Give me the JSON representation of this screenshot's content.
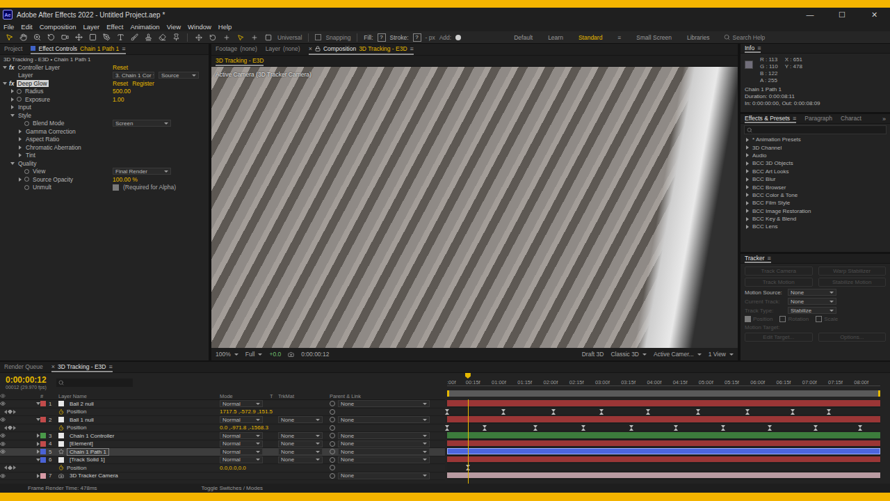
{
  "window": {
    "logo": "Ae",
    "title": "Adobe After Effects 2022 - Untitled Project.aep *",
    "controls": [
      "—",
      "☐",
      "✕"
    ]
  },
  "menu": [
    "File",
    "Edit",
    "Composition",
    "Layer",
    "Effect",
    "Animation",
    "View",
    "Window",
    "Help"
  ],
  "toolbar": {
    "tools": [
      {
        "selected": true
      },
      {
        "selected": false
      },
      {
        "selected": false
      },
      {
        "selected": false
      },
      {
        "selected": false
      },
      {
        "selected": false
      },
      {
        "selected": false
      },
      {
        "selected": false
      },
      {
        "selected": false
      },
      {
        "selected": false
      },
      {
        "selected": false
      },
      {
        "selected": false
      },
      {
        "selected": false
      }
    ],
    "axis_tools": [
      {
        "selected": false
      },
      {
        "selected": false
      },
      {
        "selected": false
      },
      {
        "selected": true
      },
      {
        "selected": false
      },
      {
        "selected": false
      }
    ],
    "axis_mode": "Universal",
    "snapping": {
      "label": "Snapping",
      "checked": false
    },
    "fill_label": "Fill:",
    "fill_value": "?",
    "stroke_label": "Stroke:",
    "stroke_value": "?",
    "stroke_width": "- px",
    "add_label": "Add:"
  },
  "workspaces": [
    {
      "label": "Default",
      "selected": false
    },
    {
      "label": "Learn",
      "selected": false
    },
    {
      "label": "Standard",
      "selected": true
    },
    {
      "label": "Small Screen",
      "selected": false
    },
    {
      "label": "Libraries",
      "selected": false
    }
  ],
  "workspace_menu": "≡",
  "help_search": {
    "placeholder": "Search Help"
  },
  "effect_controls": {
    "tabs": [
      {
        "label": "Project",
        "target": "",
        "selected": false
      },
      {
        "label": "Effect Controls",
        "target": "Chain 1 Path 1",
        "selected": true
      }
    ],
    "menu": "≡",
    "breadcrumb": "3D Tracking - E3D • Chain 1 Path 1",
    "fx_mark": "fx",
    "rows": [
      {
        "kind": "fx",
        "label": "Controller Layer",
        "depth": 0,
        "expanded": true,
        "selected": false,
        "actions": [
          "Reset"
        ]
      },
      {
        "kind": "dropdowns",
        "label": "Layer",
        "depth": 1,
        "values": [
          "3. Chain 1 Cor",
          "Source"
        ]
      },
      {
        "kind": "fx",
        "label": "Deep Glow",
        "depth": 0,
        "expanded": true,
        "selected": true,
        "actions": [
          "Reset",
          "Register"
        ]
      },
      {
        "kind": "number",
        "label": "Radius",
        "depth": 1,
        "value": "500.00"
      },
      {
        "kind": "number",
        "label": "Exposure",
        "depth": 1,
        "value": "1.00"
      },
      {
        "kind": "group",
        "label": "Input",
        "depth": 1,
        "expanded": false
      },
      {
        "kind": "group",
        "label": "Style",
        "depth": 1,
        "expanded": true
      },
      {
        "kind": "dropdown",
        "label": "Blend Mode",
        "depth": 2,
        "value": "Screen"
      },
      {
        "kind": "group",
        "label": "Gamma Correction",
        "depth": 2,
        "expanded": false
      },
      {
        "kind": "group",
        "label": "Aspect Ratio",
        "depth": 2,
        "expanded": false
      },
      {
        "kind": "group",
        "label": "Chromatic Aberration",
        "depth": 2,
        "expanded": false
      },
      {
        "kind": "group",
        "label": "Tint",
        "depth": 2,
        "expanded": false
      },
      {
        "kind": "group",
        "label": "Quality",
        "depth": 1,
        "expanded": true
      },
      {
        "kind": "dropdown",
        "label": "View",
        "depth": 2,
        "value": "Final Render"
      },
      {
        "kind": "number",
        "label": "Source Opacity",
        "depth": 2,
        "value": "100.00 %"
      },
      {
        "kind": "checkbox",
        "label": "Unmult",
        "depth": 2,
        "checked": true,
        "note": "(Required for Alpha)"
      }
    ]
  },
  "viewer": {
    "tabs": [
      {
        "label": "Footage",
        "target": "(none)",
        "selected": false
      },
      {
        "label": "Layer",
        "target": "(none)",
        "selected": false
      },
      {
        "label": "Composition",
        "target": "3D Tracking - E3D",
        "selected": true
      }
    ],
    "close": "×",
    "menu": "≡",
    "subtab": "3D Tracking - E3D",
    "overlay_label": "Active Camera (3D Tracker Camera)",
    "footer": {
      "zoom": "100%",
      "resolution": "Full",
      "exposure": "+0.0",
      "time": "0:00:00:12",
      "draft": "Draft 3D",
      "renderer": "Classic 3D",
      "view": "Active Camer...",
      "layout": "1 View"
    }
  },
  "info": {
    "title": "Info",
    "menu": "≡",
    "channels": [
      {
        "label": "R :",
        "value": "113"
      },
      {
        "label": "G :",
        "value": "110"
      },
      {
        "label": "B :",
        "value": "122"
      },
      {
        "label": "A :",
        "value": "255"
      }
    ],
    "coords": [
      {
        "label": "X :",
        "value": "651"
      },
      {
        "label": "Y :",
        "value": "478"
      }
    ],
    "lines": [
      "Chain 1 Path 1",
      "Duration: 0:00:08:11",
      "In: 0:00:00:00, Out: 0:00:08:09"
    ]
  },
  "effects_presets": {
    "tabs": [
      {
        "label": "Effects & Presets",
        "selected": true
      },
      {
        "label": "Paragraph",
        "selected": false
      },
      {
        "label": "Charact",
        "selected": false
      }
    ],
    "menu": "≡",
    "overflow": "»",
    "items": [
      "* Animation Presets",
      "3D Channel",
      "Audio",
      "BCC 3D Objects",
      "BCC Art Looks",
      "BCC Blur",
      "BCC Browser",
      "BCC Color & Tone",
      "BCC Film Style",
      "BCC Image Restoration",
      "BCC Key & Blend",
      "BCC Lens"
    ]
  },
  "tracker": {
    "title": "Tracker",
    "menu": "≡",
    "buttons": [
      {
        "label": "Track Camera",
        "disabled": true
      },
      {
        "label": "Warp Stabilizer",
        "disabled": true
      },
      {
        "label": "Track Motion",
        "disabled": true
      },
      {
        "label": "Stabilize Motion",
        "disabled": true
      }
    ],
    "fields": [
      {
        "label": "Motion Source:",
        "value": "None",
        "disabled": false
      },
      {
        "label": "Current Track:",
        "value": "None",
        "disabled": true
      },
      {
        "label": "Track Type:",
        "value": "Stabilize",
        "disabled": true
      }
    ],
    "options": [
      {
        "label": "Position",
        "checked": true,
        "disabled": true
      },
      {
        "label": "Rotation",
        "checked": false,
        "disabled": true
      },
      {
        "label": "Scale",
        "checked": false,
        "disabled": true
      }
    ],
    "target_label": "Motion Target:",
    "actions": [
      {
        "label": "Edit Target...",
        "disabled": true
      },
      {
        "label": "Options...",
        "disabled": true
      }
    ]
  },
  "timeline": {
    "tabs": [
      {
        "label": "Render Queue",
        "selected": false
      },
      {
        "label": "3D Tracking - E3D",
        "selected": true
      }
    ],
    "close": "×",
    "menu": "≡",
    "time": "0:00:00:12",
    "frames": "00012 (29.970 fps)",
    "columns": [
      "#",
      "Layer Name",
      "Mode",
      "T",
      "TrkMat",
      "Parent & Link"
    ],
    "ruler": [
      ":00f",
      "00:15f",
      "01:00f",
      "01:15f",
      "02:00f",
      "02:15f",
      "03:00f",
      "03:15f",
      "04:00f",
      "04:15f",
      "05:00f",
      "05:15f",
      "06:00f",
      "06:15f",
      "07:00f",
      "07:15f",
      "08:00f"
    ],
    "playhead": 0.048,
    "rows": [
      {
        "kind": "layer",
        "num": "1",
        "name": "Ball 2 null",
        "type": "null",
        "color": "#c24b4b",
        "bar_color": "#9b3636",
        "visible": true,
        "expanded": true,
        "selected": false,
        "mode": "Normal",
        "parent": "None"
      },
      {
        "kind": "property",
        "name": "Position",
        "value": "1717.5 ,-572.9 ,151.5",
        "keyframes": [
          0,
          0.13,
          0.245,
          0.357,
          0.464,
          0.579,
          0.693,
          0.798,
          0.881
        ]
      },
      {
        "kind": "layer",
        "num": "2",
        "name": "Ball 1 null",
        "type": "null",
        "color": "#c24b4b",
        "bar_color": "#9b3636",
        "visible": true,
        "expanded": true,
        "selected": false,
        "mode": "Normal",
        "trkmat": "None",
        "parent": "None"
      },
      {
        "kind": "property",
        "name": "Position",
        "value": "0.0 ,-971.8 ,-1568.3",
        "keyframes": [
          0,
          0.087,
          0.204,
          0.315,
          0.425,
          0.528,
          0.638,
          0.744,
          0.851,
          0.954
        ]
      },
      {
        "kind": "layer",
        "num": "3",
        "name": "Chain 1 Controller",
        "type": "solid",
        "color": "#4a9a4a",
        "bar_color": "#3c7c3c",
        "visible": true,
        "expanded": false,
        "selected": false,
        "mode": "Normal",
        "trkmat": "None",
        "parent": "None"
      },
      {
        "kind": "layer",
        "num": "4",
        "name": "[Element]",
        "type": "solid",
        "color": "#c24b4b",
        "bar_color": "#9b3636",
        "visible": true,
        "expanded": false,
        "selected": false,
        "mode": "Normal",
        "trkmat": "None",
        "parent": "None"
      },
      {
        "kind": "layer",
        "num": "5",
        "name": "Chain 1 Path 1",
        "type": "shape",
        "color": "#4a63d6",
        "bar_color": "#4c66de",
        "visible": true,
        "expanded": false,
        "selected": true,
        "mode": "Normal",
        "trkmat": "None",
        "parent": "None"
      },
      {
        "kind": "layer",
        "num": "6",
        "name": "[Track Solid 1]",
        "type": "solid",
        "color": "#4a63d6",
        "bar_color": "#9b3636",
        "visible": false,
        "expanded": true,
        "selected": false,
        "mode": "Normal",
        "trkmat": "None",
        "parent": "None"
      },
      {
        "kind": "property",
        "name": "Position",
        "value": "0.0,0.0,0.0",
        "keyframes": [
          0.048
        ]
      },
      {
        "kind": "layer",
        "num": "7",
        "name": "3D Tracker Camera",
        "type": "camera",
        "color": "#d79aa6",
        "bar_color": "#b99ba1",
        "visible": true,
        "expanded": false,
        "selected": false,
        "parent": "None"
      }
    ],
    "footer": {
      "render_time": "Frame Render Time: 478ms",
      "toggle": "Toggle Switches / Modes"
    }
  }
}
